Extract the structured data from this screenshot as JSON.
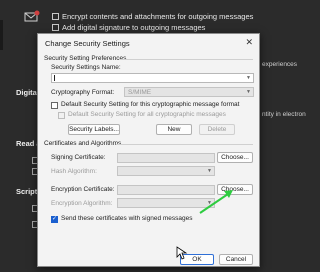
{
  "background": {
    "encrypt_label": "Encrypt contents and attachments for outgoing messages",
    "add_signature_label": "Add digital signature to outgoing messages",
    "digital_id_header": "Digital I",
    "read_as_header": "Read as",
    "script_header": "Script in",
    "right_text_1": "experiences",
    "right_text_2": "ntity in electron"
  },
  "dialog": {
    "title": "Change Security Settings",
    "close_glyph": "✕",
    "prefs_legend": "Security Setting Preferences",
    "name_label": "Security Settings Name:",
    "name_value": "",
    "crypto_label": "Cryptography Format:",
    "crypto_value": "S/MIME",
    "default_format_label": "Default Security Setting for this cryptographic message format",
    "default_all_label": "Default Security Setting for all cryptographic messages",
    "security_labels_button": "Security Labels...",
    "new_button": "New",
    "delete_button": "Delete",
    "certs_legend": "Certificates and Algorithms",
    "signing_cert_label": "Signing Certificate:",
    "hash_label": "Hash Algorithm:",
    "encryption_cert_label": "Encryption Certificate:",
    "encryption_alg_label": "Encryption Algorithm:",
    "choose_label": "Choose...",
    "send_certs_label": "Send these certificates with signed messages",
    "send_certs_checked": true,
    "ok_button": "OK",
    "cancel_button": "Cancel"
  },
  "colors": {
    "background": "#2b2b2b",
    "dialog": "#f3f3f3",
    "accent_blue": "#1a5fcf",
    "arrow_green": "#2ecc40"
  }
}
